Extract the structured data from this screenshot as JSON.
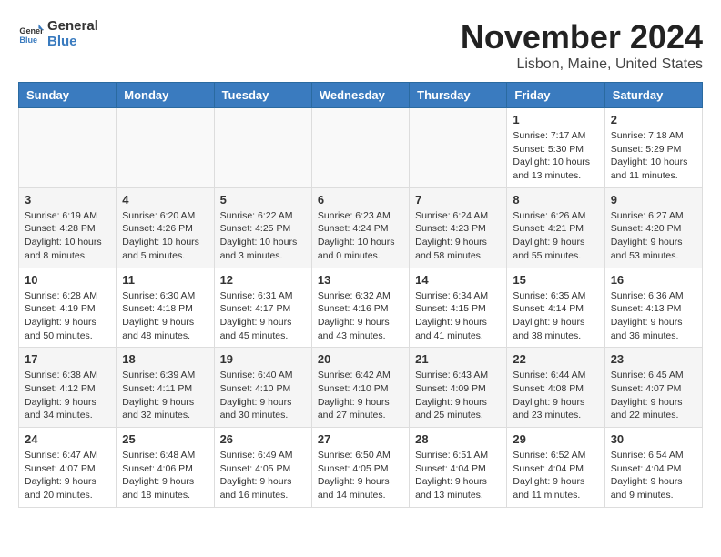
{
  "header": {
    "logo_general": "General",
    "logo_blue": "Blue",
    "month_title": "November 2024",
    "location": "Lisbon, Maine, United States"
  },
  "days_of_week": [
    "Sunday",
    "Monday",
    "Tuesday",
    "Wednesday",
    "Thursday",
    "Friday",
    "Saturday"
  ],
  "weeks": [
    {
      "days": [
        {
          "num": "",
          "empty": true
        },
        {
          "num": "",
          "empty": true
        },
        {
          "num": "",
          "empty": true
        },
        {
          "num": "",
          "empty": true
        },
        {
          "num": "",
          "empty": true
        },
        {
          "num": "1",
          "sunrise": "7:17 AM",
          "sunset": "5:30 PM",
          "daylight": "10 hours and 13 minutes."
        },
        {
          "num": "2",
          "sunrise": "7:18 AM",
          "sunset": "5:29 PM",
          "daylight": "10 hours and 11 minutes."
        }
      ]
    },
    {
      "days": [
        {
          "num": "3",
          "sunrise": "6:19 AM",
          "sunset": "4:28 PM",
          "daylight": "10 hours and 8 minutes."
        },
        {
          "num": "4",
          "sunrise": "6:20 AM",
          "sunset": "4:26 PM",
          "daylight": "10 hours and 5 minutes."
        },
        {
          "num": "5",
          "sunrise": "6:22 AM",
          "sunset": "4:25 PM",
          "daylight": "10 hours and 3 minutes."
        },
        {
          "num": "6",
          "sunrise": "6:23 AM",
          "sunset": "4:24 PM",
          "daylight": "10 hours and 0 minutes."
        },
        {
          "num": "7",
          "sunrise": "6:24 AM",
          "sunset": "4:23 PM",
          "daylight": "9 hours and 58 minutes."
        },
        {
          "num": "8",
          "sunrise": "6:26 AM",
          "sunset": "4:21 PM",
          "daylight": "9 hours and 55 minutes."
        },
        {
          "num": "9",
          "sunrise": "6:27 AM",
          "sunset": "4:20 PM",
          "daylight": "9 hours and 53 minutes."
        }
      ]
    },
    {
      "days": [
        {
          "num": "10",
          "sunrise": "6:28 AM",
          "sunset": "4:19 PM",
          "daylight": "9 hours and 50 minutes."
        },
        {
          "num": "11",
          "sunrise": "6:30 AM",
          "sunset": "4:18 PM",
          "daylight": "9 hours and 48 minutes."
        },
        {
          "num": "12",
          "sunrise": "6:31 AM",
          "sunset": "4:17 PM",
          "daylight": "9 hours and 45 minutes."
        },
        {
          "num": "13",
          "sunrise": "6:32 AM",
          "sunset": "4:16 PM",
          "daylight": "9 hours and 43 minutes."
        },
        {
          "num": "14",
          "sunrise": "6:34 AM",
          "sunset": "4:15 PM",
          "daylight": "9 hours and 41 minutes."
        },
        {
          "num": "15",
          "sunrise": "6:35 AM",
          "sunset": "4:14 PM",
          "daylight": "9 hours and 38 minutes."
        },
        {
          "num": "16",
          "sunrise": "6:36 AM",
          "sunset": "4:13 PM",
          "daylight": "9 hours and 36 minutes."
        }
      ]
    },
    {
      "days": [
        {
          "num": "17",
          "sunrise": "6:38 AM",
          "sunset": "4:12 PM",
          "daylight": "9 hours and 34 minutes."
        },
        {
          "num": "18",
          "sunrise": "6:39 AM",
          "sunset": "4:11 PM",
          "daylight": "9 hours and 32 minutes."
        },
        {
          "num": "19",
          "sunrise": "6:40 AM",
          "sunset": "4:10 PM",
          "daylight": "9 hours and 30 minutes."
        },
        {
          "num": "20",
          "sunrise": "6:42 AM",
          "sunset": "4:10 PM",
          "daylight": "9 hours and 27 minutes."
        },
        {
          "num": "21",
          "sunrise": "6:43 AM",
          "sunset": "4:09 PM",
          "daylight": "9 hours and 25 minutes."
        },
        {
          "num": "22",
          "sunrise": "6:44 AM",
          "sunset": "4:08 PM",
          "daylight": "9 hours and 23 minutes."
        },
        {
          "num": "23",
          "sunrise": "6:45 AM",
          "sunset": "4:07 PM",
          "daylight": "9 hours and 22 minutes."
        }
      ]
    },
    {
      "days": [
        {
          "num": "24",
          "sunrise": "6:47 AM",
          "sunset": "4:07 PM",
          "daylight": "9 hours and 20 minutes."
        },
        {
          "num": "25",
          "sunrise": "6:48 AM",
          "sunset": "4:06 PM",
          "daylight": "9 hours and 18 minutes."
        },
        {
          "num": "26",
          "sunrise": "6:49 AM",
          "sunset": "4:05 PM",
          "daylight": "9 hours and 16 minutes."
        },
        {
          "num": "27",
          "sunrise": "6:50 AM",
          "sunset": "4:05 PM",
          "daylight": "9 hours and 14 minutes."
        },
        {
          "num": "28",
          "sunrise": "6:51 AM",
          "sunset": "4:04 PM",
          "daylight": "9 hours and 13 minutes."
        },
        {
          "num": "29",
          "sunrise": "6:52 AM",
          "sunset": "4:04 PM",
          "daylight": "9 hours and 11 minutes."
        },
        {
          "num": "30",
          "sunrise": "6:54 AM",
          "sunset": "4:04 PM",
          "daylight": "9 hours and 9 minutes."
        }
      ]
    }
  ]
}
